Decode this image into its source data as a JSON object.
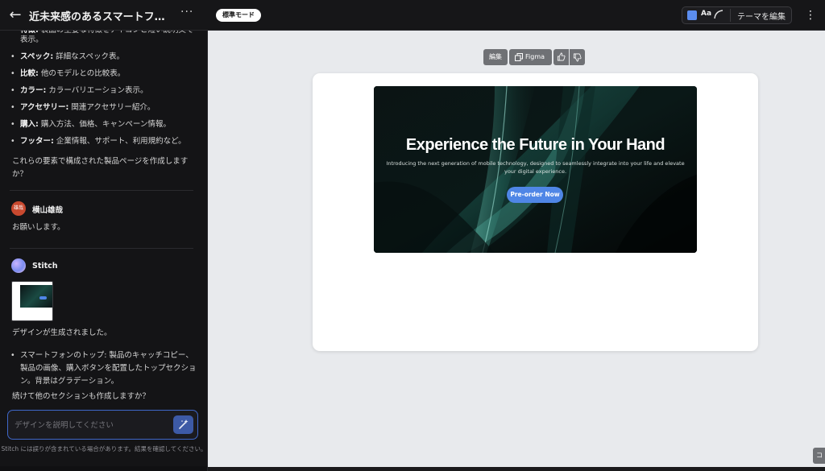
{
  "header": {
    "back_icon": "arrow-left-icon",
    "project_title": "近未来感のあるスマートフォンの...",
    "more": "···",
    "mode_label": "標準モード",
    "theme": {
      "swatch_color": "#5b8def",
      "font_label": "Aa",
      "edit_label": "テーマを編集"
    },
    "menu_icon": "kebab-icon"
  },
  "chat": {
    "top_bullets": [
      {
        "key": "特徴:",
        "text": " 製品の主要な特徴をアイコンと短い説明文で表示。"
      },
      {
        "key": "スペック:",
        "text": " 詳細なスペック表。"
      },
      {
        "key": "比較:",
        "text": " 他のモデルとの比較表。"
      },
      {
        "key": "カラー:",
        "text": " カラーバリエーション表示。"
      },
      {
        "key": "アクセサリー:",
        "text": " 関連アクセサリー紹介。"
      },
      {
        "key": "購入:",
        "text": " 購入方法、価格、キャンペーン情報。"
      },
      {
        "key": "フッター:",
        "text": " 企業情報、サポート、利用規約など。"
      }
    ],
    "question": "これらの要素で構成された製品ページを作成しますか？",
    "user": {
      "avatar_text": "雄哉",
      "name": "横山雄哉",
      "message": "お願いします。"
    },
    "assistant": {
      "name": "Stitch",
      "generated": "デザインが生成されました。",
      "bullets": [
        "スマートフォンのトップ: 製品のキャッチコピー、製品の画像、購入ボタンを配置したトップセクション。背景はグラデーション。"
      ],
      "follow_up": "続けて他のセクションも作成しますか？"
    },
    "input_placeholder": "デザインを説明してください",
    "send_icon": "magic-wand-icon",
    "disclaimer": "Stitch には誤りが含まれている場合があります。結果を確認してください。"
  },
  "canvas": {
    "toolbar": {
      "edit_label": "編集",
      "figma_label": "Figma",
      "thumbs_up_icon": "thumbs-up-icon",
      "thumbs_down_icon": "thumbs-down-icon"
    },
    "hero": {
      "title": "Experience the Future in Your Hand",
      "subtitle": "Introducing the next generation of mobile technology, designed to seamlessly integrate into your life and elevate your digital experience.",
      "cta": "Pre-order Now",
      "cta_color": "#4f86e6"
    },
    "corner_label": "コ"
  }
}
